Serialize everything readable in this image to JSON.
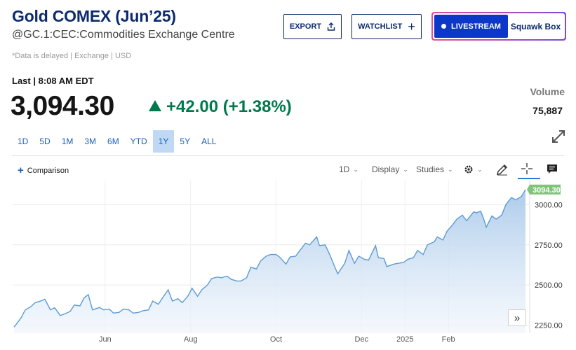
{
  "header": {
    "title": "Gold COMEX (Jun’25)",
    "subtitle": "@GC.1:CEC:Commodities Exchange Centre",
    "delayed_note": "*Data is delayed | Exchange | USD",
    "export_label": "EXPORT",
    "watchlist_label": "WATCHLIST",
    "livestream_label": "LIVESTREAM",
    "squawk_label": "Squawk Box"
  },
  "quote": {
    "last_label": "Last | 8:08 AM EDT",
    "price": "3,094.30",
    "change": "+42.00 (+1.38%)",
    "direction": "up",
    "volume_label": "Volume",
    "volume": "75,887"
  },
  "ranges": [
    {
      "label": "1D"
    },
    {
      "label": "5D"
    },
    {
      "label": "1M"
    },
    {
      "label": "3M"
    },
    {
      "label": "6M"
    },
    {
      "label": "YTD"
    },
    {
      "label": "1Y",
      "active": true
    },
    {
      "label": "5Y"
    },
    {
      "label": "ALL"
    }
  ],
  "toolbar": {
    "comparison_label": "Comparison",
    "interval_label": "1D",
    "display_label": "Display",
    "studies_label": "Studies"
  },
  "colors": {
    "brand": "#0c2a6d",
    "up": "#007a4d",
    "line": "#5b9bd5",
    "last_price_badge": "#7fc47a"
  },
  "chart_data": {
    "type": "area",
    "ylim": [
      2200,
      3150
    ],
    "y_ticks": [
      2250,
      2500,
      2750,
      3000
    ],
    "y_tick_labels": [
      "2250.00",
      "2500.00",
      "2750.00",
      "3000.00"
    ],
    "x_ticks": [
      {
        "label": "Jun",
        "date": "2024-06-01"
      },
      {
        "label": "Aug",
        "date": "2024-08-01"
      },
      {
        "label": "Oct",
        "date": "2024-10-01"
      },
      {
        "label": "Dec",
        "date": "2024-12-01"
      },
      {
        "label": "2025",
        "date": "2025-01-01"
      },
      {
        "label": "Feb",
        "date": "2025-02-01"
      }
    ],
    "last_price_label": "3094.30",
    "series": [
      {
        "points": [
          [
            "2024-03-28",
            2238
          ],
          [
            "2024-04-02",
            2295
          ],
          [
            "2024-04-05",
            2345
          ],
          [
            "2024-04-09",
            2365
          ],
          [
            "2024-04-12",
            2390
          ],
          [
            "2024-04-16",
            2400
          ],
          [
            "2024-04-19",
            2412
          ],
          [
            "2024-04-23",
            2345
          ],
          [
            "2024-04-26",
            2358
          ],
          [
            "2024-04-30",
            2310
          ],
          [
            "2024-05-03",
            2320
          ],
          [
            "2024-05-07",
            2335
          ],
          [
            "2024-05-10",
            2375
          ],
          [
            "2024-05-14",
            2370
          ],
          [
            "2024-05-17",
            2420
          ],
          [
            "2024-05-20",
            2440
          ],
          [
            "2024-05-23",
            2345
          ],
          [
            "2024-05-28",
            2360
          ],
          [
            "2024-05-31",
            2345
          ],
          [
            "2024-06-04",
            2350
          ],
          [
            "2024-06-07",
            2325
          ],
          [
            "2024-06-11",
            2330
          ],
          [
            "2024-06-14",
            2350
          ],
          [
            "2024-06-18",
            2345
          ],
          [
            "2024-06-21",
            2325
          ],
          [
            "2024-06-25",
            2330
          ],
          [
            "2024-06-28",
            2340
          ],
          [
            "2024-07-02",
            2345
          ],
          [
            "2024-07-05",
            2400
          ],
          [
            "2024-07-09",
            2380
          ],
          [
            "2024-07-12",
            2420
          ],
          [
            "2024-07-16",
            2470
          ],
          [
            "2024-07-19",
            2400
          ],
          [
            "2024-07-23",
            2415
          ],
          [
            "2024-07-26",
            2390
          ],
          [
            "2024-07-30",
            2430
          ],
          [
            "2024-08-02",
            2480
          ],
          [
            "2024-08-06",
            2430
          ],
          [
            "2024-08-09",
            2470
          ],
          [
            "2024-08-13",
            2500
          ],
          [
            "2024-08-16",
            2540
          ],
          [
            "2024-08-20",
            2550
          ],
          [
            "2024-08-23",
            2545
          ],
          [
            "2024-08-27",
            2555
          ],
          [
            "2024-08-30",
            2535
          ],
          [
            "2024-09-03",
            2525
          ],
          [
            "2024-09-06",
            2525
          ],
          [
            "2024-09-10",
            2545
          ],
          [
            "2024-09-13",
            2610
          ],
          [
            "2024-09-17",
            2600
          ],
          [
            "2024-09-20",
            2650
          ],
          [
            "2024-09-24",
            2680
          ],
          [
            "2024-09-27",
            2690
          ],
          [
            "2024-10-01",
            2690
          ],
          [
            "2024-10-04",
            2670
          ],
          [
            "2024-10-08",
            2630
          ],
          [
            "2024-10-11",
            2675
          ],
          [
            "2024-10-15",
            2680
          ],
          [
            "2024-10-18",
            2715
          ],
          [
            "2024-10-22",
            2760
          ],
          [
            "2024-10-25",
            2750
          ],
          [
            "2024-10-30",
            2800
          ],
          [
            "2024-11-01",
            2745
          ],
          [
            "2024-11-05",
            2750
          ],
          [
            "2024-11-08",
            2695
          ],
          [
            "2024-11-12",
            2610
          ],
          [
            "2024-11-14",
            2570
          ],
          [
            "2024-11-19",
            2635
          ],
          [
            "2024-11-22",
            2715
          ],
          [
            "2024-11-26",
            2635
          ],
          [
            "2024-11-29",
            2680
          ],
          [
            "2024-12-03",
            2660
          ],
          [
            "2024-12-06",
            2655
          ],
          [
            "2024-12-11",
            2745
          ],
          [
            "2024-12-13",
            2670
          ],
          [
            "2024-12-17",
            2665
          ],
          [
            "2024-12-19",
            2615
          ],
          [
            "2024-12-24",
            2630
          ],
          [
            "2024-12-27",
            2635
          ],
          [
            "2024-12-31",
            2640
          ],
          [
            "2025-01-03",
            2660
          ],
          [
            "2025-01-07",
            2670
          ],
          [
            "2025-01-10",
            2715
          ],
          [
            "2025-01-14",
            2690
          ],
          [
            "2025-01-17",
            2750
          ],
          [
            "2025-01-22",
            2770
          ],
          [
            "2025-01-24",
            2800
          ],
          [
            "2025-01-28",
            2780
          ],
          [
            "2025-01-31",
            2835
          ],
          [
            "2025-02-04",
            2875
          ],
          [
            "2025-02-07",
            2910
          ],
          [
            "2025-02-11",
            2935
          ],
          [
            "2025-02-14",
            2900
          ],
          [
            "2025-02-19",
            2955
          ],
          [
            "2025-02-21",
            2950
          ],
          [
            "2025-02-24",
            2960
          ],
          [
            "2025-02-26",
            2915
          ],
          [
            "2025-02-28",
            2860
          ],
          [
            "2025-03-04",
            2930
          ],
          [
            "2025-03-07",
            2910
          ],
          [
            "2025-03-11",
            2935
          ],
          [
            "2025-03-14",
            3000
          ],
          [
            "2025-03-18",
            3045
          ],
          [
            "2025-03-21",
            3030
          ],
          [
            "2025-03-25",
            3050
          ],
          [
            "2025-03-28",
            3094.3
          ]
        ]
      }
    ]
  }
}
